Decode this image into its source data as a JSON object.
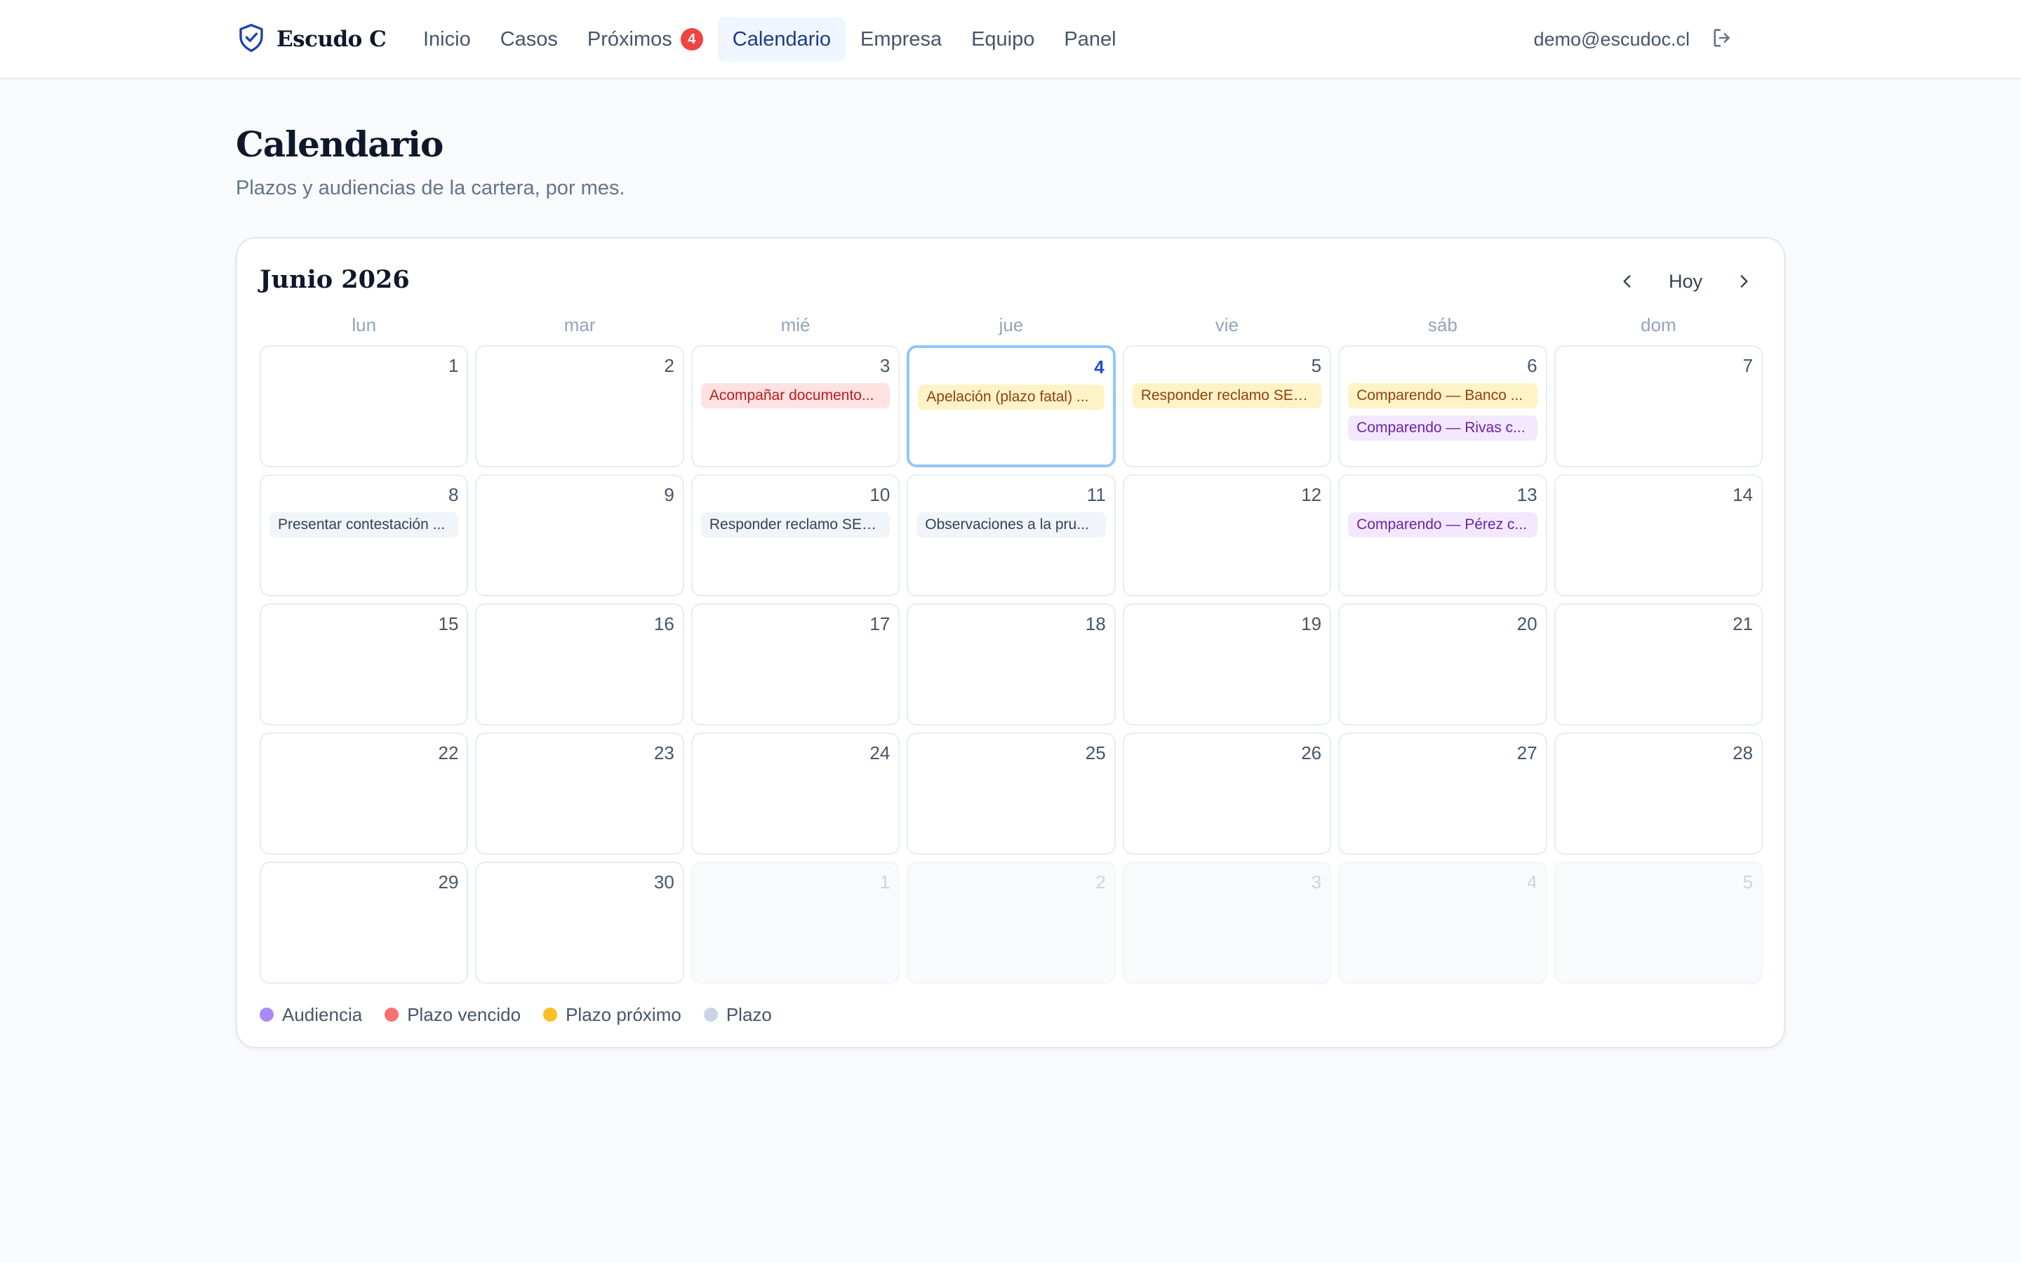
{
  "app": {
    "brand_name": "Escudo C",
    "brand_icon": "shield-check-icon"
  },
  "nav": {
    "items": [
      {
        "label": "Inicio",
        "active": false
      },
      {
        "label": "Casos",
        "active": false
      },
      {
        "label": "Próximos",
        "active": false,
        "badge": "4"
      },
      {
        "label": "Calendario",
        "active": true
      },
      {
        "label": "Empresa",
        "active": false
      },
      {
        "label": "Equipo",
        "active": false
      },
      {
        "label": "Panel",
        "active": false
      }
    ]
  },
  "user": {
    "email": "demo@escudoc.cl",
    "logout_icon": "logout-icon"
  },
  "page": {
    "title": "Calendario",
    "subtitle": "Plazos y audiencias de la cartera, por mes."
  },
  "calendar": {
    "month_label": "Junio 2026",
    "today_label": "Hoy",
    "prev_icon": "chevron-left-icon",
    "next_icon": "chevron-right-icon",
    "weekdays": [
      "lun",
      "mar",
      "mié",
      "jue",
      "vie",
      "sáb",
      "dom"
    ],
    "weeks": [
      [
        {
          "day": "1",
          "in_month": true,
          "today": false,
          "events": []
        },
        {
          "day": "2",
          "in_month": true,
          "today": false,
          "events": []
        },
        {
          "day": "3",
          "in_month": true,
          "today": false,
          "events": [
            {
              "label": "Acompañar documento...",
              "kind": "overdue"
            }
          ]
        },
        {
          "day": "4",
          "in_month": true,
          "today": true,
          "events": [
            {
              "label": "Apelación (plazo fatal) ...",
              "kind": "upcoming"
            }
          ]
        },
        {
          "day": "5",
          "in_month": true,
          "today": false,
          "events": [
            {
              "label": "Responder reclamo SER...",
              "kind": "upcoming"
            }
          ]
        },
        {
          "day": "6",
          "in_month": true,
          "today": false,
          "events": [
            {
              "label": "Comparendo — Banco ...",
              "kind": "upcoming"
            },
            {
              "label": "Comparendo — Rivas c...",
              "kind": "hearing"
            }
          ]
        },
        {
          "day": "7",
          "in_month": true,
          "today": false,
          "events": []
        }
      ],
      [
        {
          "day": "8",
          "in_month": true,
          "today": false,
          "events": [
            {
              "label": "Presentar contestación ...",
              "kind": "plain"
            }
          ]
        },
        {
          "day": "9",
          "in_month": true,
          "today": false,
          "events": []
        },
        {
          "day": "10",
          "in_month": true,
          "today": false,
          "events": [
            {
              "label": "Responder reclamo SER...",
              "kind": "plain"
            }
          ]
        },
        {
          "day": "11",
          "in_month": true,
          "today": false,
          "events": [
            {
              "label": "Observaciones a la pru...",
              "kind": "plain"
            }
          ]
        },
        {
          "day": "12",
          "in_month": true,
          "today": false,
          "events": []
        },
        {
          "day": "13",
          "in_month": true,
          "today": false,
          "events": [
            {
              "label": "Comparendo — Pérez c...",
              "kind": "hearing"
            }
          ]
        },
        {
          "day": "14",
          "in_month": true,
          "today": false,
          "events": []
        }
      ],
      [
        {
          "day": "15",
          "in_month": true,
          "today": false,
          "events": []
        },
        {
          "day": "16",
          "in_month": true,
          "today": false,
          "events": []
        },
        {
          "day": "17",
          "in_month": true,
          "today": false,
          "events": []
        },
        {
          "day": "18",
          "in_month": true,
          "today": false,
          "events": []
        },
        {
          "day": "19",
          "in_month": true,
          "today": false,
          "events": []
        },
        {
          "day": "20",
          "in_month": true,
          "today": false,
          "events": []
        },
        {
          "day": "21",
          "in_month": true,
          "today": false,
          "events": []
        }
      ],
      [
        {
          "day": "22",
          "in_month": true,
          "today": false,
          "events": []
        },
        {
          "day": "23",
          "in_month": true,
          "today": false,
          "events": []
        },
        {
          "day": "24",
          "in_month": true,
          "today": false,
          "events": []
        },
        {
          "day": "25",
          "in_month": true,
          "today": false,
          "events": []
        },
        {
          "day": "26",
          "in_month": true,
          "today": false,
          "events": []
        },
        {
          "day": "27",
          "in_month": true,
          "today": false,
          "events": []
        },
        {
          "day": "28",
          "in_month": true,
          "today": false,
          "events": []
        }
      ],
      [
        {
          "day": "29",
          "in_month": true,
          "today": false,
          "events": []
        },
        {
          "day": "30",
          "in_month": true,
          "today": false,
          "events": []
        },
        {
          "day": "1",
          "in_month": false,
          "today": false,
          "events": []
        },
        {
          "day": "2",
          "in_month": false,
          "today": false,
          "events": []
        },
        {
          "day": "3",
          "in_month": false,
          "today": false,
          "events": []
        },
        {
          "day": "4",
          "in_month": false,
          "today": false,
          "events": []
        },
        {
          "day": "5",
          "in_month": false,
          "today": false,
          "events": []
        }
      ]
    ]
  },
  "legend": [
    {
      "label": "Audiencia",
      "color": "#a78bfa"
    },
    {
      "label": "Plazo vencido",
      "color": "#f87171"
    },
    {
      "label": "Plazo próximo",
      "color": "#fbbf24"
    },
    {
      "label": "Plazo",
      "color": "#cbd5e1"
    }
  ],
  "colors": {
    "accent": "#1e40af",
    "active_nav_bg": "#eff6ff",
    "badge": "#ef4444",
    "today_border": "#93c5fd"
  }
}
